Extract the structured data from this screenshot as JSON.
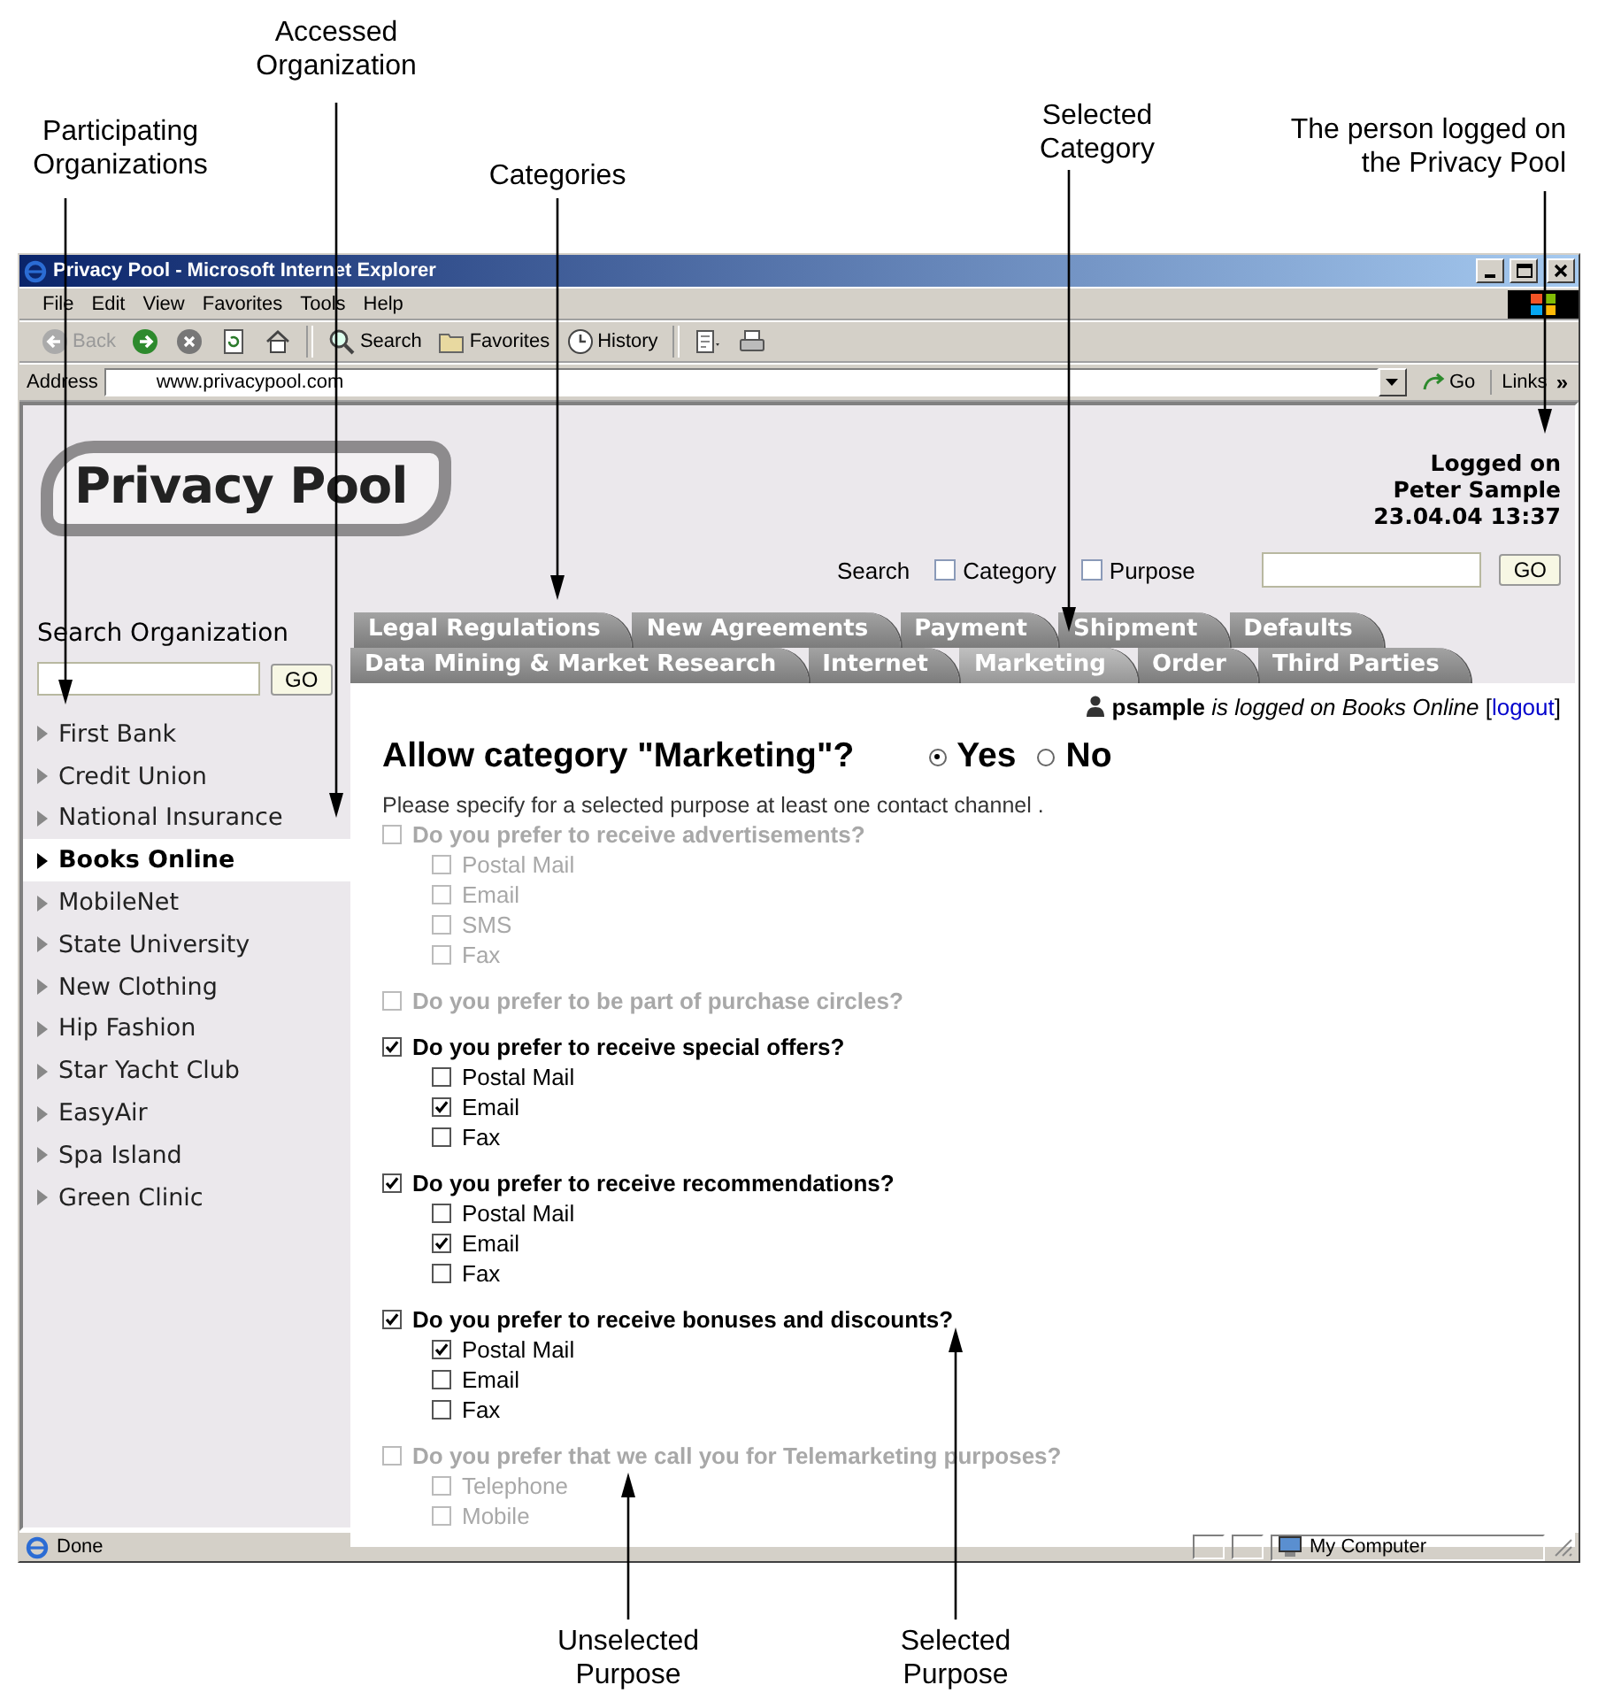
{
  "window": {
    "title": "Privacy Pool - Microsoft Internet Explorer",
    "menu": [
      "File",
      "Edit",
      "View",
      "Favorites",
      "Tools",
      "Help"
    ],
    "toolbar": [
      {
        "kind": "back",
        "label": "Back",
        "disabled": true
      },
      {
        "kind": "forward",
        "disabled": false
      },
      {
        "kind": "stop"
      },
      {
        "kind": "refresh"
      },
      {
        "kind": "home"
      },
      {
        "kind": "search",
        "label": "Search"
      },
      {
        "kind": "favorites",
        "label": "Favorites"
      },
      {
        "kind": "history",
        "label": "History"
      },
      {
        "kind": "edit"
      },
      {
        "kind": "print"
      }
    ],
    "address": {
      "label": "Address",
      "value": "www.privacypool.com",
      "go": "Go",
      "links": "Links",
      "links_chevron": "»"
    },
    "status": {
      "text": "Done",
      "zone": "My Computer"
    }
  },
  "header": {
    "logo": "Privacy Pool",
    "login": [
      "Logged on",
      "Peter Sample",
      "23.04.04 13:37"
    ],
    "search": {
      "label": "Search",
      "options": [
        {
          "label": "Category",
          "checked": false
        },
        {
          "label": "Purpose",
          "checked": false
        }
      ],
      "button": "GO"
    }
  },
  "sidebar": {
    "title": "Search Organization",
    "button": "GO",
    "organizations": [
      {
        "name": "First Bank",
        "selected": false
      },
      {
        "name": "Credit Union",
        "selected": false
      },
      {
        "name": "National Insurance",
        "selected": false
      },
      {
        "name": "Books Online",
        "selected": true
      },
      {
        "name": "MobileNet",
        "selected": false
      },
      {
        "name": "State University",
        "selected": false
      },
      {
        "name": "New Clothing",
        "selected": false
      },
      {
        "name": "Hip Fashion",
        "selected": false
      },
      {
        "name": "Star Yacht Club",
        "selected": false
      },
      {
        "name": "EasyAir",
        "selected": false
      },
      {
        "name": "Spa Island",
        "selected": false
      },
      {
        "name": "Green Clinic",
        "selected": false
      }
    ]
  },
  "tabs": [
    {
      "items": [
        {
          "label": "Legal Regulations",
          "selected": false
        },
        {
          "label": "New Agreements",
          "selected": false
        },
        {
          "label": "Payment",
          "selected": false
        },
        {
          "label": "Shipment",
          "selected": false
        },
        {
          "label": "Defaults",
          "selected": false
        }
      ]
    },
    {
      "items": [
        {
          "label": "Data Mining & Market Research",
          "selected": false
        },
        {
          "label": "Internet",
          "selected": false
        },
        {
          "label": "Marketing",
          "selected": true
        },
        {
          "label": "Order",
          "selected": false
        },
        {
          "label": "Third Parties",
          "selected": false
        }
      ]
    }
  ],
  "user_note": {
    "text": "**psample** *is logged on Books Online* [",
    "link": "logout",
    "after": "]"
  },
  "question": {
    "title": "Allow category \"Marketing\"?",
    "options": [
      {
        "label": "Yes",
        "selected": true
      },
      {
        "label": "No",
        "selected": false
      }
    ]
  },
  "instruction": "Please specify for a selected purpose at least one contact channel .",
  "purposes": [
    {
      "label": "Do you prefer to receive advertisements?",
      "checked": false,
      "channels": [
        {
          "label": "Postal Mail",
          "checked": false
        },
        {
          "label": "Email",
          "checked": false
        },
        {
          "label": "SMS",
          "checked": false
        },
        {
          "label": "Fax",
          "checked": false
        }
      ]
    },
    {
      "label": "Do you prefer to be part of purchase circles?",
      "checked": false
    },
    {
      "label": "Do you prefer to receive special offers?",
      "checked": true,
      "channels": [
        {
          "label": "Postal Mail",
          "checked": false
        },
        {
          "label": "Email",
          "checked": true
        },
        {
          "label": "Fax",
          "checked": false
        }
      ]
    },
    {
      "label": "Do you prefer to receive recommendations?",
      "checked": true,
      "channels": [
        {
          "label": "Postal Mail",
          "checked": false
        },
        {
          "label": "Email",
          "checked": true
        },
        {
          "label": "Fax",
          "checked": false
        }
      ]
    },
    {
      "label": "Do you prefer to receive bonuses and discounts?",
      "checked": true,
      "channels": [
        {
          "label": "Postal Mail",
          "checked": true
        },
        {
          "label": "Email",
          "checked": false
        },
        {
          "label": "Fax",
          "checked": false
        }
      ]
    },
    {
      "label": "Do you prefer that we call you for Telemarketing purposes?",
      "checked": false,
      "channels": [
        {
          "label": "Telephone",
          "checked": false
        },
        {
          "label": "Mobile",
          "checked": false
        }
      ]
    }
  ],
  "annotations": [
    {
      "text": "Participating\nOrganizations"
    },
    {
      "text": "Accessed\nOrganization"
    },
    {
      "text": "Categories"
    },
    {
      "text": "Selected\nCategory"
    },
    {
      "text": "The person logged on\nthe Privacy Pool"
    },
    {
      "text": "Unselected\nPurpose"
    },
    {
      "text": "Selected\nPurpose"
    }
  ]
}
